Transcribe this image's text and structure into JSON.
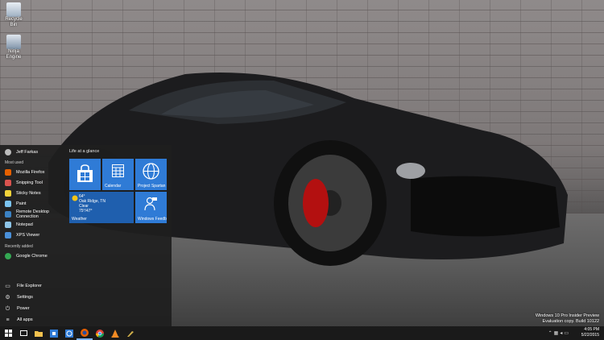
{
  "desktop": {
    "icons": [
      {
        "label": "Recycle Bin"
      },
      {
        "label": "Ninja Engine"
      }
    ],
    "watermark": {
      "line1": "Windows 10 Pro Insider Preview",
      "line2": "Evaluation copy. Build 10122"
    }
  },
  "start_menu": {
    "user_name": "Jeff Farkas",
    "most_used_label": "Most used",
    "most_used": [
      {
        "label": "Mozilla Firefox",
        "icon": "firefox-icon",
        "color": "#e66000"
      },
      {
        "label": "Snipping Tool",
        "icon": "snipping-tool-icon",
        "color": "#d9534f"
      },
      {
        "label": "Sticky Notes",
        "icon": "sticky-notes-icon",
        "color": "#f2d33a"
      },
      {
        "label": "Paint",
        "icon": "paint-icon",
        "color": "#7bc4f0"
      },
      {
        "label": "Remote Desktop Connection",
        "icon": "remote-desktop-icon",
        "color": "#3b82c4"
      },
      {
        "label": "Notepad",
        "icon": "notepad-icon",
        "color": "#8ec5e8"
      },
      {
        "label": "XPS Viewer",
        "icon": "xps-viewer-icon",
        "color": "#4a90d9"
      }
    ],
    "recently_added_label": "Recently added",
    "recently_added": [
      {
        "label": "Google Chrome",
        "icon": "chrome-icon",
        "color": "#34a853"
      }
    ],
    "bottom": [
      {
        "label": "File Explorer",
        "icon": "folder-icon",
        "glyph": "▭"
      },
      {
        "label": "Settings",
        "icon": "gear-icon",
        "glyph": "⚙"
      },
      {
        "label": "Power",
        "icon": "power-icon",
        "glyph": "⏻"
      },
      {
        "label": "All apps",
        "icon": "list-icon",
        "glyph": "≡"
      }
    ],
    "tiles_title": "Life at a glance",
    "tiles": {
      "store": {
        "label": ""
      },
      "calendar": {
        "label": "Calendar"
      },
      "spartan": {
        "label": "Project Spartan"
      },
      "weather": {
        "label": "Weather",
        "temp": "64°",
        "location": "Oak Ridge, TN",
        "condition": "Clear",
        "range": "75°/47°"
      },
      "feeds": {
        "label": "Windows Feedb"
      }
    }
  },
  "taskbar": {
    "time": "4:05 PM",
    "date": "5/22/2015",
    "apps": [
      {
        "name": "task-view",
        "color": "#ffffff"
      },
      {
        "name": "file-explorer",
        "color": "#f2c14e"
      },
      {
        "name": "store",
        "color": "#2f7bd6"
      },
      {
        "name": "spartan-browser",
        "color": "#2f7bd6"
      },
      {
        "name": "firefox",
        "color": "#e66000"
      },
      {
        "name": "chrome",
        "color": "#34a853"
      },
      {
        "name": "vlc",
        "color": "#f08a24"
      },
      {
        "name": "paint",
        "color": "#d4b24a"
      }
    ]
  },
  "colors": {
    "accent": "#2f7bd6",
    "start_bg": "#1e1e1e",
    "taskbar_bg": "#1a1a1a"
  }
}
